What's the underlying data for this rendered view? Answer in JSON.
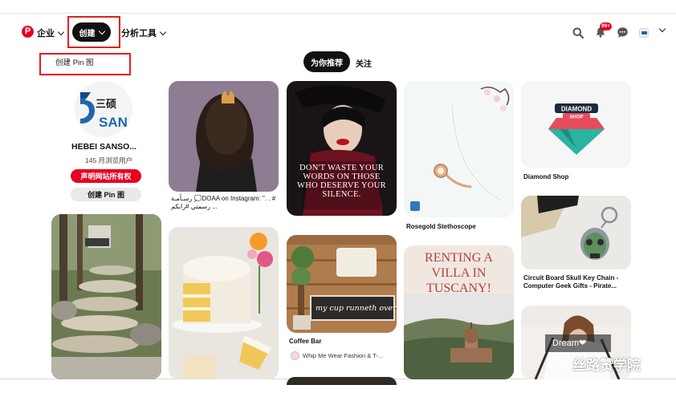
{
  "header": {
    "logo_letter": "P",
    "business_label": "企业",
    "create_label": "创建",
    "analytics_label": "分析工具",
    "notification_badge": "99+",
    "icons": [
      "search-icon",
      "bell-icon",
      "chat-icon",
      "chevron-down-icon"
    ]
  },
  "create_menu": {
    "item_label": "创建 Pin 图"
  },
  "tabs": [
    {
      "label": "为你推荐",
      "active": true
    },
    {
      "label": "关注",
      "active": false
    }
  ],
  "profile": {
    "avatar_text": "三硕",
    "avatar_text2": "SAN",
    "name": "HEBEI SANSO...",
    "views": "145 月浏览用户",
    "claim_label": "声明网站所有权",
    "create_pin_label": "创建 Pin 图"
  },
  "pins": {
    "girl_crown": {
      "caption": "رسـأمـة 💭DOAA on Instagram: \". . # رسمتي #رابكم ..."
    },
    "quote": {
      "text_lines": [
        "DON'T WASTE YOUR",
        "WORDS ON THOSE",
        "WHO DESERVE YOUR",
        "SILENCE."
      ]
    },
    "stethoscope": {
      "caption": "Rosegold Stethoscope"
    },
    "diamond_shop": {
      "logo_line1": "DIAMOND",
      "logo_line2": "SHOP",
      "caption": "Diamond Shop"
    },
    "skull_keychain": {
      "caption": "Circuit Board Skull Key Chain - Computer Geek Gifts - Pirate..."
    },
    "coffee_bar": {
      "sign_line1": "my cup runneth over",
      "caption": "Coffee Bar",
      "sub": "Whip Me Wear Fashion & T-..."
    },
    "tuscany": {
      "text_lines": [
        "RENTING A",
        "VILLA IN",
        "TUSCANY!"
      ]
    },
    "dream": {
      "text": "Dream❤"
    }
  },
  "watermark": {
    "text": "丝路赞学院"
  },
  "colors": {
    "brand_red": "#e60023",
    "annotation_red": "#e02020",
    "pill_black": "#111111"
  }
}
